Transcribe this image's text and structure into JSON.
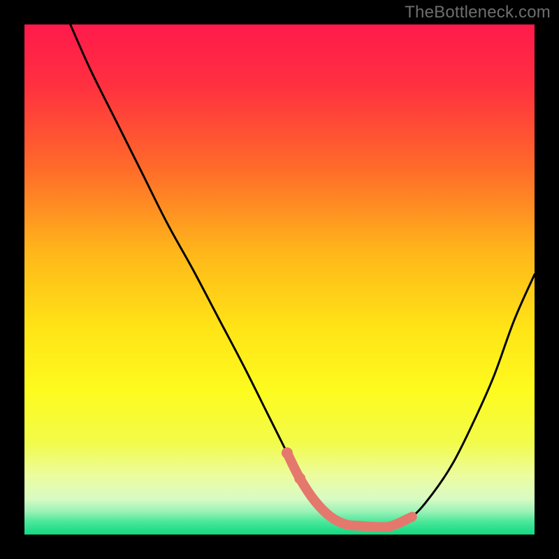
{
  "watermark": "TheBottleneck.com",
  "colors": {
    "frame": "#000000",
    "curve_stroke": "#000000",
    "highlight": "#e5786d",
    "gradient_stops": [
      {
        "offset": 0.0,
        "color": "#ff1a4b"
      },
      {
        "offset": 0.12,
        "color": "#ff3040"
      },
      {
        "offset": 0.28,
        "color": "#ff6a2a"
      },
      {
        "offset": 0.45,
        "color": "#ffb81a"
      },
      {
        "offset": 0.6,
        "color": "#ffe516"
      },
      {
        "offset": 0.72,
        "color": "#fdfb1f"
      },
      {
        "offset": 0.82,
        "color": "#f2fb4a"
      },
      {
        "offset": 0.885,
        "color": "#ecfca0"
      },
      {
        "offset": 0.93,
        "color": "#d8fbc4"
      },
      {
        "offset": 0.955,
        "color": "#9af2b7"
      },
      {
        "offset": 0.975,
        "color": "#4ae79a"
      },
      {
        "offset": 1.0,
        "color": "#12d981"
      }
    ]
  },
  "chart_data": {
    "type": "line",
    "title": "",
    "xlabel": "",
    "ylabel": "",
    "xlim": [
      0,
      100
    ],
    "ylim": [
      0,
      100
    ],
    "grid": false,
    "series": [
      {
        "name": "curve",
        "x": [
          9,
          13,
          18,
          23,
          28,
          33,
          38,
          43,
          48,
          51.5,
          54,
          57,
          60,
          63,
          66,
          69,
          72,
          76,
          80,
          84,
          88,
          92,
          96,
          100
        ],
        "values": [
          100,
          91,
          81,
          71,
          61,
          52,
          42.5,
          33,
          23,
          16,
          11,
          6.5,
          3.5,
          2,
          1.7,
          1.5,
          1.7,
          3.5,
          8,
          14,
          22,
          31,
          42,
          51
        ]
      }
    ],
    "highlight_segment": {
      "series": "curve",
      "x_start": 51.5,
      "x_end": 76,
      "note": "thick salmon overlay with dots near trough"
    }
  }
}
